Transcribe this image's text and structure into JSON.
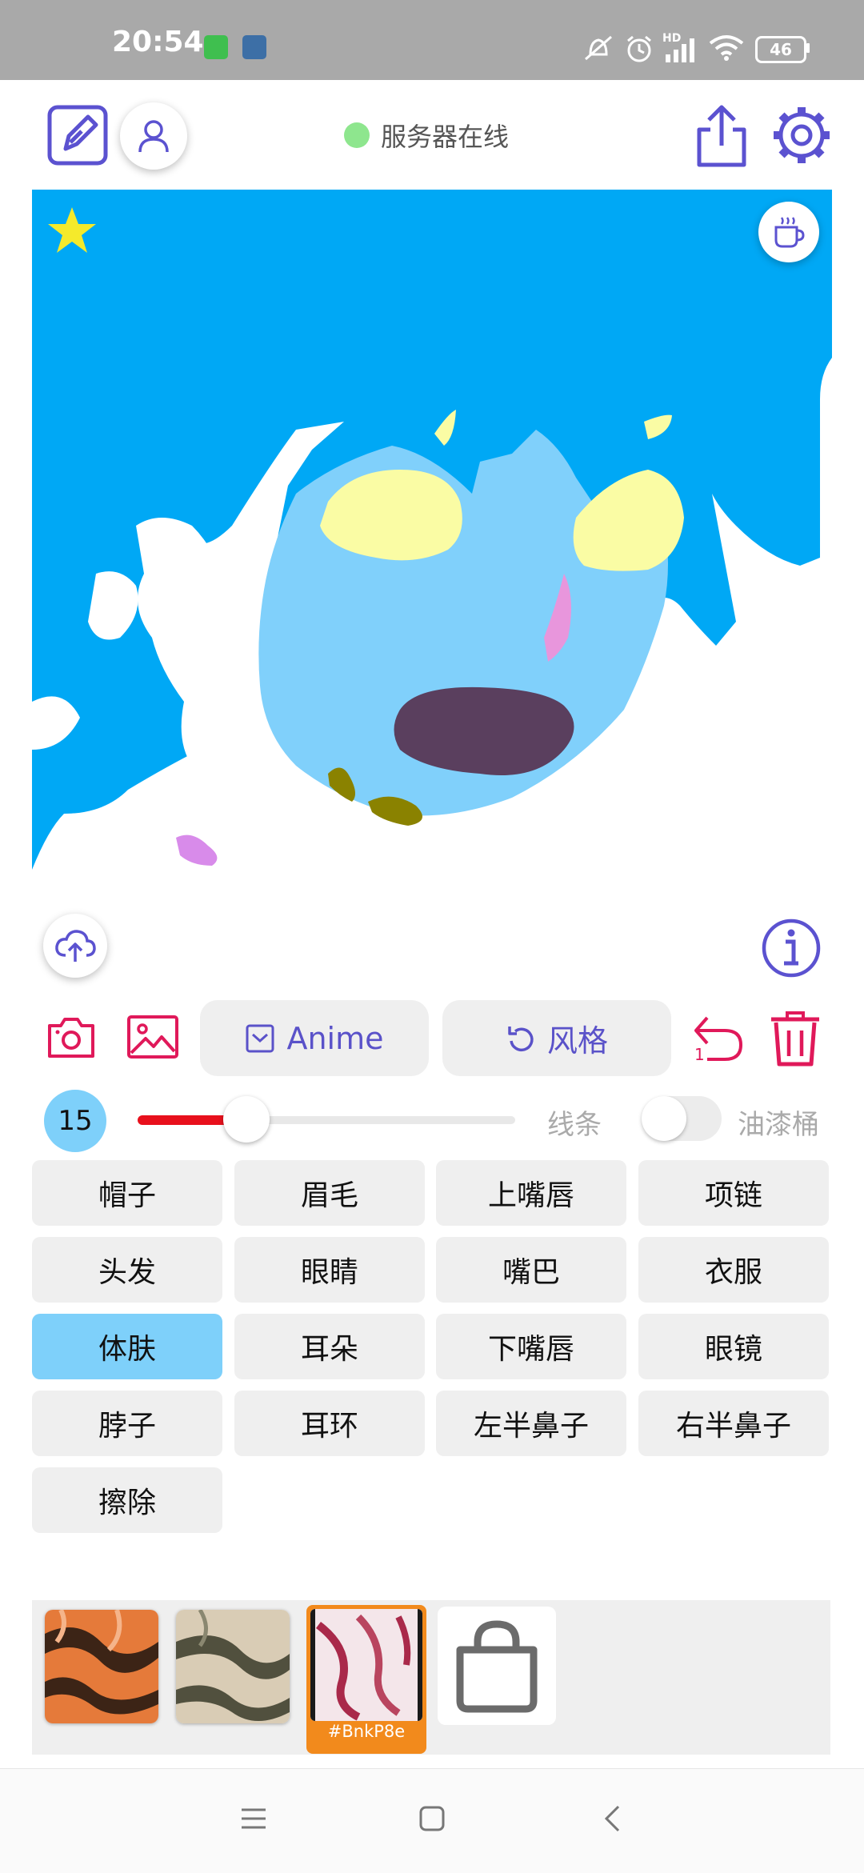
{
  "status_bar": {
    "time": "20:54",
    "network_label": "HD",
    "battery": "46",
    "icons": [
      "app-icon-green",
      "app-icon-settings",
      "mute-icon",
      "alarm-icon",
      "signal-icon",
      "wifi-icon",
      "battery-icon"
    ]
  },
  "top_bar": {
    "server_status": "服务器在线",
    "server_status_color": "#8ee68e",
    "icons": [
      "edit-icon",
      "user-icon",
      "share-icon",
      "settings-icon"
    ]
  },
  "canvas": {
    "overlay_icons": [
      "star-icon",
      "coffee-icon",
      "upload-cloud-icon",
      "info-icon"
    ]
  },
  "toolbar": {
    "anime_label": "Anime",
    "style_label": "风格",
    "undo_count": "1",
    "icons": [
      "camera-icon",
      "image-icon",
      "checkbox-icon",
      "refresh-icon",
      "undo-icon",
      "trash-icon"
    ]
  },
  "brush": {
    "size": "15",
    "slider_value_fraction": 0.22,
    "line_label": "线条",
    "bucket_label": "油漆桶",
    "bucket_enabled": false,
    "accent_color": "#e8101c"
  },
  "parts": [
    {
      "label": "帽子",
      "active": false
    },
    {
      "label": "眉毛",
      "active": false
    },
    {
      "label": "上嘴唇",
      "active": false
    },
    {
      "label": "项链",
      "active": false
    },
    {
      "label": "头发",
      "active": false
    },
    {
      "label": "眼睛",
      "active": false
    },
    {
      "label": "嘴巴",
      "active": false
    },
    {
      "label": "衣服",
      "active": false
    },
    {
      "label": "体肤",
      "active": true
    },
    {
      "label": "耳朵",
      "active": false
    },
    {
      "label": "下嘴唇",
      "active": false
    },
    {
      "label": "眼镜",
      "active": false
    },
    {
      "label": "脖子",
      "active": false
    },
    {
      "label": "耳环",
      "active": false
    },
    {
      "label": "左半鼻子",
      "active": false
    },
    {
      "label": "右半鼻子",
      "active": false
    },
    {
      "label": "擦除",
      "active": false
    }
  ],
  "textures": {
    "selected_code": "#BnkP8e",
    "selected_color": "#f28a1c",
    "shop_icon": "shopping-bag-icon"
  },
  "nav_bar": {
    "icons": [
      "menu-icon",
      "home-icon",
      "back-icon"
    ]
  }
}
